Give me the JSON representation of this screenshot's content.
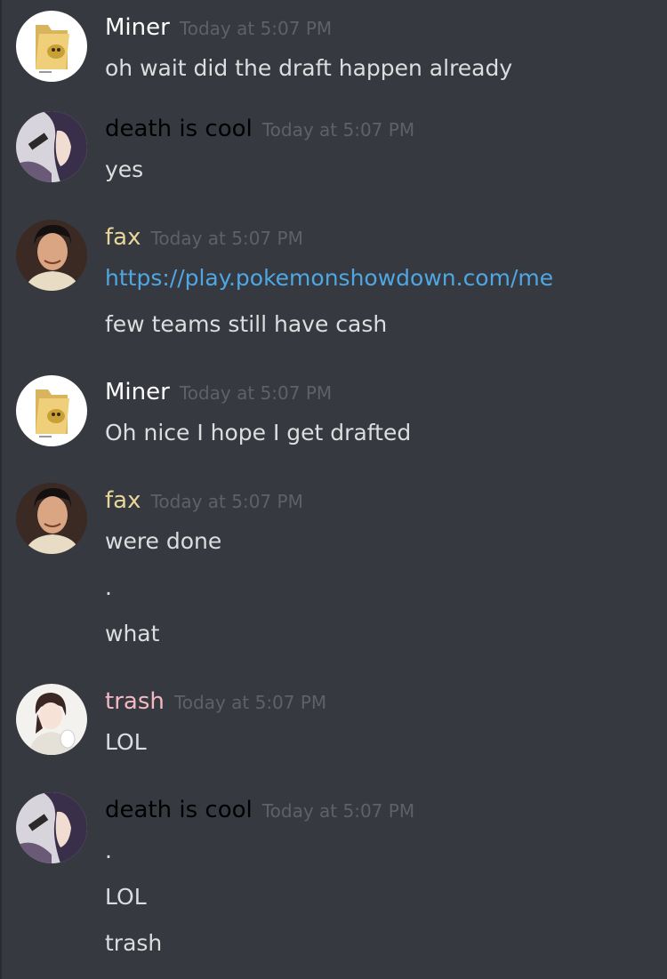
{
  "colors": {
    "background": "#36393f",
    "text": "#dcddde",
    "timestamp": "#5e6168",
    "link": "#4ea7e3"
  },
  "messages": [
    {
      "author": "Miner",
      "author_color": "#ffffff",
      "avatar_icon": "folder-pokemon-avatar-icon",
      "timestamp": "Today at 5:07 PM",
      "lines": [
        "oh wait did the draft happen already"
      ]
    },
    {
      "author": "death is cool",
      "author_color": "#000000",
      "avatar_icon": "anime-girl-avatar-icon",
      "timestamp": "Today at 5:07 PM",
      "lines": [
        "yes"
      ]
    },
    {
      "author": "fax",
      "author_color": "#e8d699",
      "avatar_icon": "man-portrait-avatar-icon",
      "timestamp": "Today at 5:07 PM",
      "link": "https://play.pokemonshowdown.com/me",
      "lines": [
        "few teams still have cash"
      ]
    },
    {
      "author": "Miner",
      "author_color": "#ffffff",
      "avatar_icon": "folder-pokemon-avatar-icon",
      "timestamp": "Today at 5:07 PM",
      "lines": [
        "Oh nice I hope I get drafted"
      ]
    },
    {
      "author": "fax",
      "author_color": "#e8d699",
      "avatar_icon": "man-portrait-avatar-icon",
      "timestamp": "Today at 5:07 PM",
      "lines": [
        "were done",
        ".",
        "what"
      ]
    },
    {
      "author": "trash",
      "author_color": "#f4b8c2",
      "avatar_icon": "anime-character-avatar-icon",
      "timestamp": "Today at 5:07 PM",
      "lines": [
        "LOL"
      ]
    },
    {
      "author": "death is cool",
      "author_color": "#000000",
      "avatar_icon": "anime-girl-avatar-icon",
      "timestamp": "Today at 5:07 PM",
      "lines": [
        ".",
        "LOL",
        "trash"
      ]
    }
  ]
}
